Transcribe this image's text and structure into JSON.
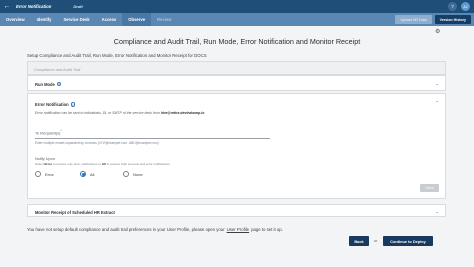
{
  "topbar": {
    "back_icon": "arrow-left-icon",
    "title": "Error Notification",
    "status": "Draft",
    "help_icon": "help-icon",
    "user_initials": "AJ"
  },
  "tabs": [
    {
      "label": "Overview"
    },
    {
      "label": "Identify"
    },
    {
      "label": "Service Desk"
    },
    {
      "label": "Access"
    },
    {
      "label": "Observe"
    },
    {
      "label": "Review"
    }
  ],
  "tabbar_buttons": {
    "upload": "Upload HR Data",
    "history": "Version History"
  },
  "page": {
    "heading": "Compliance and Audit Trail, Run Mode, Error Notification and Monitor Receipt",
    "subtext": "Setup Compliance and Audit Trail, Run Mode, Error Notification and Monitor Receipt for DOCS"
  },
  "sections": {
    "compliance": {
      "label": "Compliance and Audit Trail"
    },
    "run_mode": {
      "label": "Run Mode"
    },
    "error_notification": {
      "label": "Error Notification",
      "desc_prefix": "Error notification can be sent to individuals, DL or SMTP of the service desk from ",
      "desc_email": "hire@retire.devtrakomp.io",
      "recipient_label": "To Recipient(s)",
      "recipient_required": "*",
      "recipient_value": "",
      "recipient_hint": "Enter multiple emails separated by commas (XYZ@example.com, ABC@example.com)",
      "notify_label": "Notify Upon",
      "notify_hint_1": "Select ",
      "notify_hint_error": "Error",
      "notify_hint_2": " to receive only error notifications or ",
      "notify_hint_all": "All",
      "notify_hint_3": " to receive both success and error notifications",
      "options": [
        "Error",
        "All",
        "None"
      ],
      "selected": "All",
      "save_label": "Save"
    },
    "monitor_receipt": {
      "label": "Monitor Receipt of Scheduled HR Extract"
    }
  },
  "footer": {
    "note_prefix": "You have not setup default compliance and audit trail preferences in your User Profile, please open your",
    "note_link": "User Profile",
    "note_suffix": "page to set it up.",
    "back_label": "Back",
    "or_label": "or",
    "deploy_label": "Continue to Deploy"
  }
}
